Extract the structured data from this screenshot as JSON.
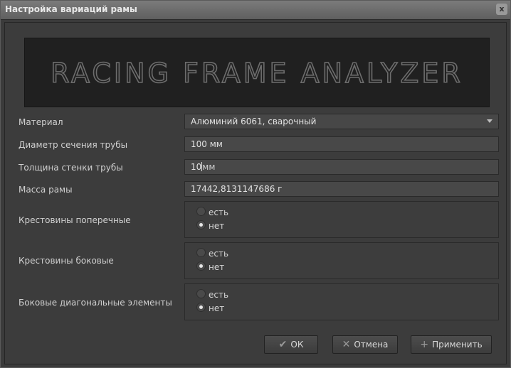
{
  "window": {
    "title": "Настройка вариаций рамы",
    "close_glyph": "x"
  },
  "banner": {
    "text": "RACING FRAME ANALYZER"
  },
  "form": {
    "material": {
      "label": "Материал",
      "value": "Алюминий 6061, сварочный"
    },
    "diameter": {
      "label": "Диаметр сечения трубы",
      "value": "100 мм"
    },
    "wall": {
      "label": "Толщина стенки трубы",
      "value": "10",
      "unit": "мм"
    },
    "mass": {
      "label": "Масса рамы",
      "value": "17442,8131147686 г"
    },
    "cross_transverse": {
      "label": "Крестовины поперечные",
      "options": [
        "есть",
        "нет"
      ],
      "selected": "нет"
    },
    "cross_side": {
      "label": "Крестовины боковые",
      "options": [
        "есть",
        "нет"
      ],
      "selected": "нет"
    },
    "side_diagonal": {
      "label": "Боковые диагональные элементы",
      "options": [
        "есть",
        "нет"
      ],
      "selected": "нет"
    }
  },
  "buttons": {
    "ok": "ОК",
    "cancel": "Отмена",
    "apply": "Применить"
  },
  "colors": {
    "background": "#3c3c3c",
    "titlebar": "#6e6e6e",
    "field": "#484848",
    "banner": "#202020"
  }
}
